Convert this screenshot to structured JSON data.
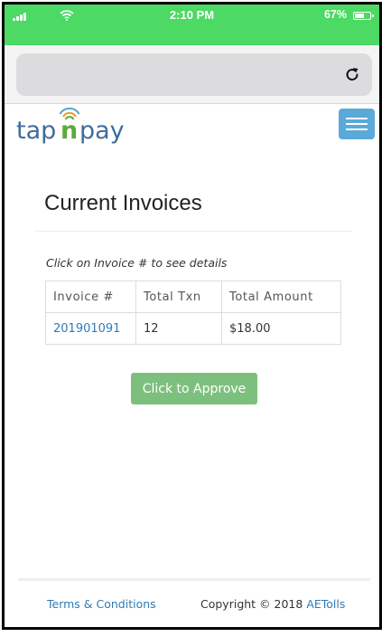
{
  "status_bar": {
    "time": "2:10 PM",
    "subtitle": "",
    "battery_percent": "67%",
    "battery_level": 0.67,
    "icons": [
      "signal-icon",
      "wifi-icon",
      "battery-icon"
    ],
    "color": "#4cd964"
  },
  "browser": {
    "url": "",
    "icons": [
      "reload-icon"
    ]
  },
  "header": {
    "logo_text": "tap n pay",
    "menu_icon": "hamburger-menu-icon",
    "menu_color": "#5aa9d9"
  },
  "main": {
    "title": "Current Invoices",
    "hint": "Click on Invoice # to see details",
    "table": {
      "columns": [
        "Invoice #",
        "Total Txn",
        "Total Amount"
      ],
      "rows": [
        {
          "invoice": "201901091",
          "txn": "12",
          "amount": "$18.00"
        }
      ]
    },
    "approve_label": "Click to Approve",
    "approve_color": "#7dc07d"
  },
  "footer": {
    "terms": "Terms & Conditions",
    "copyright_prefix": "Copyright © 2018",
    "company": "AETolls",
    "link_color": "#2f7bb7"
  }
}
